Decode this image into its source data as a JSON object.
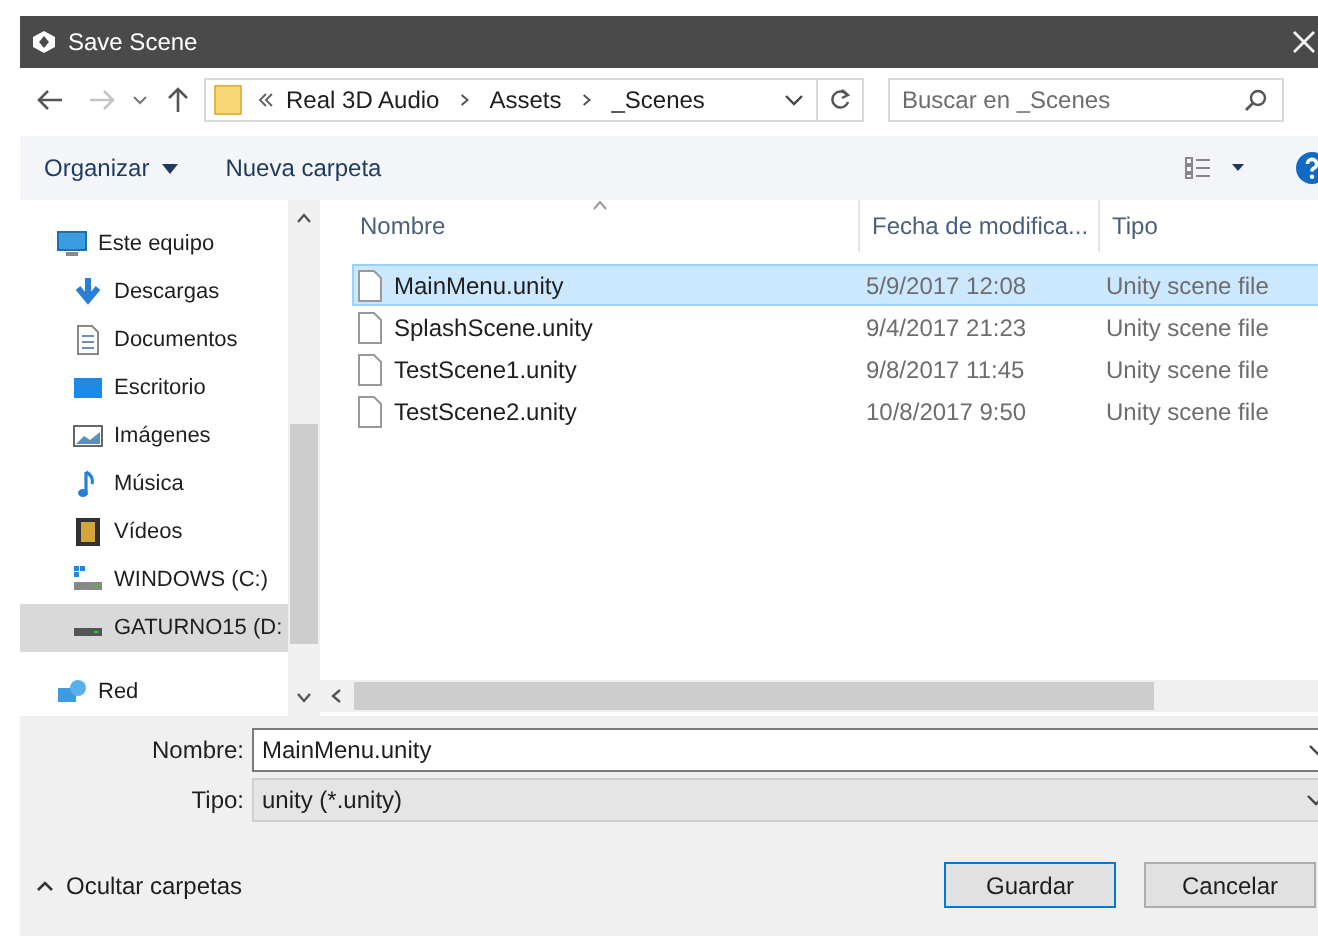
{
  "window": {
    "title": "Save Scene"
  },
  "address": {
    "crumbs": [
      "Real 3D Audio",
      "Assets",
      "_Scenes"
    ],
    "search_placeholder": "Buscar en _Scenes"
  },
  "toolbar": {
    "organize": "Organizar",
    "new_folder": "Nueva carpeta"
  },
  "sidebar": {
    "items": [
      {
        "label": "Este equipo",
        "kind": "computer",
        "selected": false
      },
      {
        "label": "Descargas",
        "kind": "download",
        "selected": false
      },
      {
        "label": "Documentos",
        "kind": "document",
        "selected": false
      },
      {
        "label": "Escritorio",
        "kind": "desktop",
        "selected": false
      },
      {
        "label": "Imágenes",
        "kind": "images",
        "selected": false
      },
      {
        "label": "Música",
        "kind": "music",
        "selected": false
      },
      {
        "label": "Vídeos",
        "kind": "video",
        "selected": false
      },
      {
        "label": "WINDOWS (C:)",
        "kind": "drive_c",
        "selected": false
      },
      {
        "label": "GATURNO15 (D:",
        "kind": "drive",
        "selected": true
      },
      {
        "label": "Red",
        "kind": "network",
        "selected": false
      }
    ]
  },
  "table": {
    "columns": [
      "Nombre",
      "Fecha de modifica...",
      "Tipo"
    ],
    "rows": [
      {
        "name": "MainMenu.unity",
        "date": "5/9/2017 12:08",
        "type": "Unity scene file",
        "selected": true
      },
      {
        "name": "SplashScene.unity",
        "date": "9/4/2017 21:23",
        "type": "Unity scene file",
        "selected": false
      },
      {
        "name": "TestScene1.unity",
        "date": "9/8/2017 11:45",
        "type": "Unity scene file",
        "selected": false
      },
      {
        "name": "TestScene2.unity",
        "date": "10/8/2017 9:50",
        "type": "Unity scene file",
        "selected": false
      }
    ]
  },
  "form": {
    "name_label": "Nombre:",
    "name_value": "MainMenu.unity",
    "type_label": "Tipo:",
    "type_value": "unity (*.unity)"
  },
  "footer": {
    "hide_folders": "Ocultar carpetas",
    "save": "Guardar",
    "cancel": "Cancelar"
  }
}
